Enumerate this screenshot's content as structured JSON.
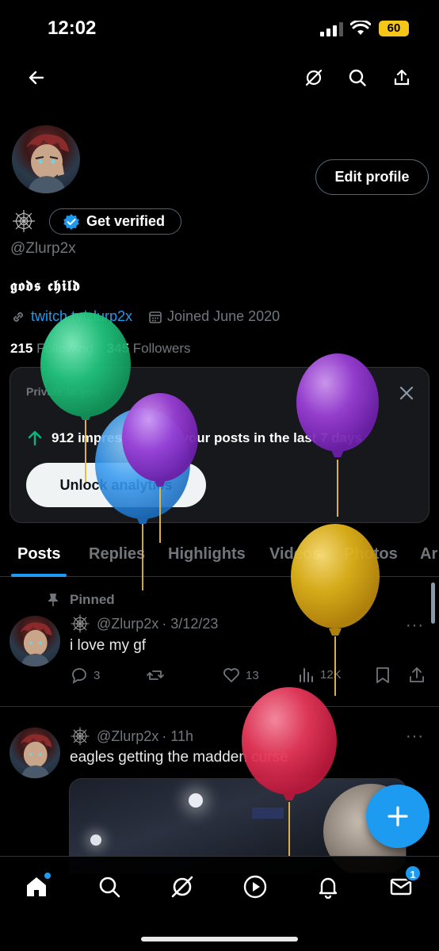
{
  "status_bar": {
    "time": "12:02",
    "battery": "60"
  },
  "profile": {
    "badge_button": "Get verified",
    "edit_button": "Edit profile",
    "handle": "@Zlurp2x",
    "bio": "𝖌𝖔𝖉𝖘 𝖈𝖍𝖎𝖑𝖉",
    "link": "twitch.tv/zlurp2x",
    "joined": "Joined June 2020",
    "following_count": "215",
    "following_label": "Following",
    "followers_count": "345",
    "followers_label": "Followers"
  },
  "analytics_card": {
    "private_label": "Private to you",
    "impressions": "912 impressions on your posts in the last 7 days",
    "unlock_button": "Unlock analytics"
  },
  "tabs": [
    "Posts",
    "Replies",
    "Highlights",
    "Videos",
    "Photos",
    "Ar"
  ],
  "posts": [
    {
      "pinned_label": "Pinned",
      "handle": "@Zlurp2x",
      "date": "· 3/12/23",
      "text": "i love my gf",
      "replies": "3",
      "likes": "13",
      "views": "12K"
    },
    {
      "handle": "@Zlurp2x",
      "date": "· 11h",
      "text": "eagles getting the madden curse"
    }
  ],
  "bottom_nav": {
    "messages_badge": "1"
  },
  "colors": {
    "accent": "#1d9bf0",
    "background": "#000000",
    "muted": "#71767b"
  },
  "icons": [
    "back-arrow-icon",
    "grok-icon",
    "search-icon",
    "share-icon",
    "cobweb-icon",
    "verified-badge-icon",
    "link-icon",
    "calendar-icon",
    "up-arrow-icon",
    "close-icon",
    "pin-icon",
    "reply-icon",
    "retweet-icon",
    "heart-icon",
    "views-icon",
    "bookmark-icon",
    "more-icon",
    "plus-icon",
    "home-icon",
    "explore-icon",
    "play-icon",
    "bell-icon",
    "mail-icon"
  ]
}
